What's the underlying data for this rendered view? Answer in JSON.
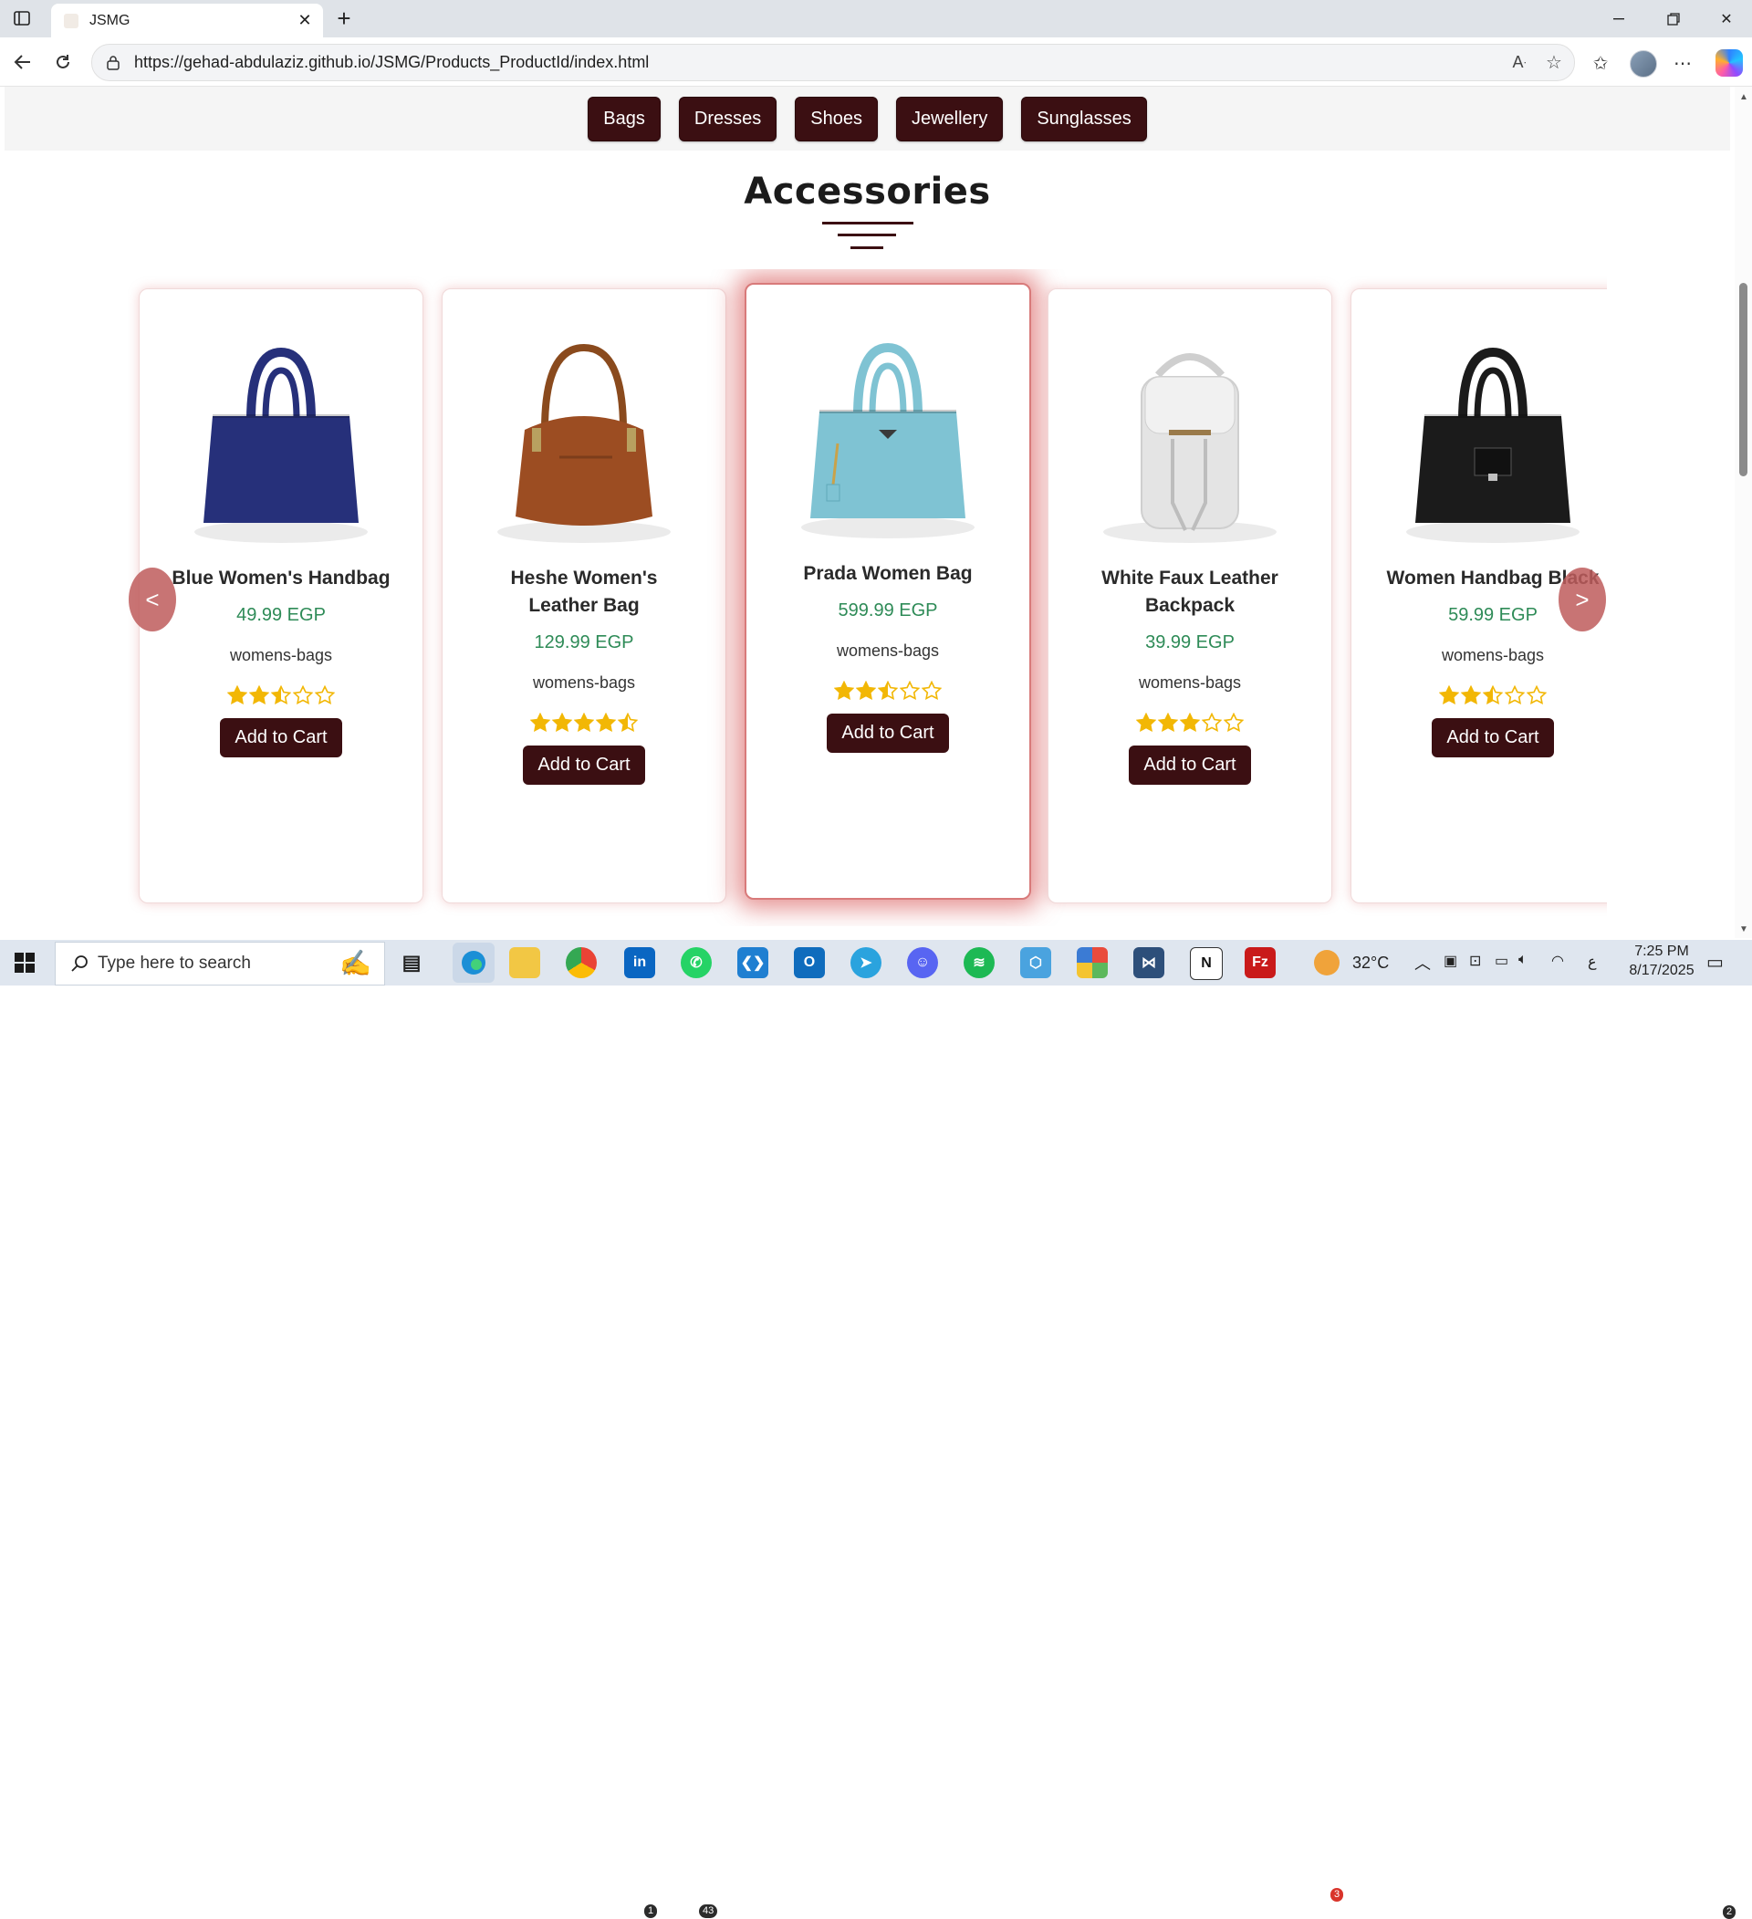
{
  "browser": {
    "tab_title": "JSMG",
    "url": "https://gehad-abdulaziz.github.io/JSMG/Products_ProductId/index.html"
  },
  "categories": [
    "Bags",
    "Dresses",
    "Shoes",
    "Jewellery",
    "Sunglasses"
  ],
  "section_title": "Accessories",
  "carousel": {
    "prev_label": "<",
    "next_label": ">",
    "products": [
      {
        "name": "Blue Women's Handbag",
        "price": "49.99 EGP",
        "category": "womens-bags",
        "rating": 2.5,
        "button": "Add to Cart",
        "color": "#26307a"
      },
      {
        "name": "Heshe Women's Leather Bag",
        "price": "129.99 EGP",
        "category": "womens-bags",
        "rating": 4.5,
        "button": "Add to Cart",
        "color": "#9c4d22"
      },
      {
        "name": "Prada Women Bag",
        "price": "599.99 EGP",
        "category": "womens-bags",
        "rating": 2.5,
        "button": "Add to Cart",
        "color": "#7fc3d3"
      },
      {
        "name": "White Faux Leather Backpack",
        "price": "39.99 EGP",
        "category": "womens-bags",
        "rating": 3,
        "button": "Add to Cart",
        "color": "#e4e4e4"
      },
      {
        "name": "Women Handbag Black",
        "price": "59.99 EGP",
        "category": "womens-bags",
        "rating": 2.5,
        "button": "Add to Cart",
        "color": "#1b1b1b"
      }
    ]
  },
  "taskbar": {
    "search_placeholder": "Type here to search",
    "weather": "32°C",
    "time": "7:25 PM",
    "date": "8/17/2025",
    "linkedin_badge": "1",
    "whatsapp_badge": "43",
    "weather_badge": "3",
    "notifications_badge": "2",
    "ime": "ع"
  }
}
